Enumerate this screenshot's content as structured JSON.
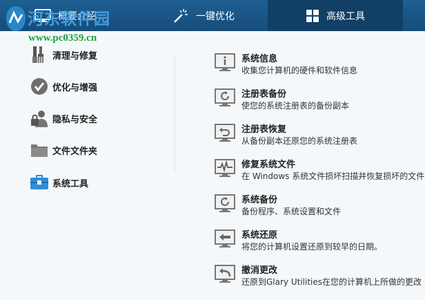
{
  "tabs": [
    {
      "label": "概要介绍",
      "icon": "monitor-icon"
    },
    {
      "label": "一键优化",
      "icon": "magic-wand-icon"
    },
    {
      "label": "高级工具",
      "icon": "grid-icon"
    }
  ],
  "watermark": {
    "title": "河东软件园",
    "url": "www.pc0359.cn"
  },
  "nav": [
    {
      "label": "清理与修复",
      "icon": "brush-icon"
    },
    {
      "label": "优化与增强",
      "icon": "checkmark-icon"
    },
    {
      "label": "隐私与安全",
      "icon": "lock-user-icon"
    },
    {
      "label": "文件文件夹",
      "icon": "folder-icon"
    },
    {
      "label": "系统工具",
      "icon": "toolbox-icon"
    }
  ],
  "tools": [
    {
      "title": "系统信息",
      "desc": "收集您计算机的硬件和软件信息",
      "icon": "info-monitor-icon"
    },
    {
      "title": "注册表备份",
      "desc": "使您的系统注册表的备份副本",
      "icon": "refresh-monitor-icon"
    },
    {
      "title": "注册表恢复",
      "desc": "从备份副本还原您的系统注册表",
      "icon": "restore-monitor-icon"
    },
    {
      "title": "修复系统文件",
      "desc": "在 Windows 系统文件损坏扫描并恢复损坏的文件 ‹",
      "icon": "pulse-monitor-icon"
    },
    {
      "title": "系统备份",
      "desc": "备份程序、系统设置和文件",
      "icon": "backup-monitor-icon"
    },
    {
      "title": "系统还原",
      "desc": "将您的计算机设置还原到较早的日期。",
      "icon": "back-arrow-monitor-icon"
    },
    {
      "title": "撤消更改",
      "desc": "还原到Glary Utilities在您的计算机上所做的更改",
      "icon": "undo-monitor-icon"
    }
  ],
  "colors": {
    "topbar": "#1a5686",
    "active_tab": "#123f66",
    "accent": "#2d8fd5",
    "background": "#f4f8fb"
  }
}
